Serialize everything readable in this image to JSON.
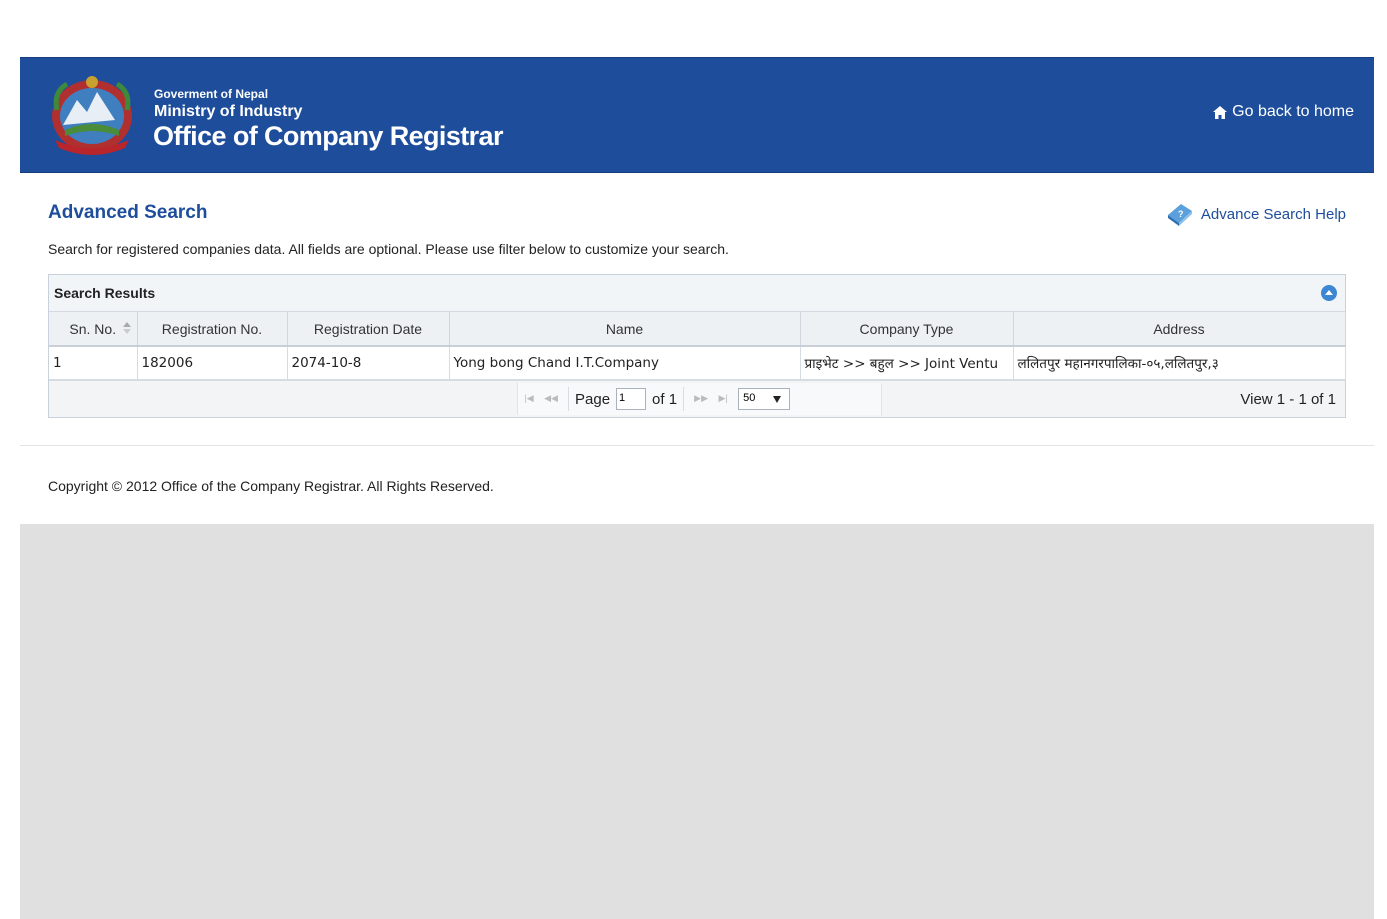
{
  "header": {
    "gov_line": "Goverment of Nepal",
    "ministry_line": "Ministry of Industry",
    "office_line": "Office of Company Registrar",
    "home_link": "Go back to home"
  },
  "main": {
    "title": "Advanced Search",
    "help_link": "Advance Search Help",
    "description": "Search for registered companies data. All fields are optional. Please use filter below to customize your search."
  },
  "grid": {
    "caption": "Search Results",
    "columns": [
      "Sn. No.",
      "Registration No.",
      "Registration Date",
      "Name",
      "Company Type",
      "Address"
    ],
    "rows": [
      [
        "1",
        "182006",
        "2074-10-8",
        "Yong bong Chand I.T.Company",
        "प्राइभेट >> बहुल >> Joint Ventu",
        "ललितपुर महानगरपालिका-०५,ललितपुर,३"
      ]
    ],
    "pager": {
      "page_label": "Page",
      "page_value": "1",
      "of_label": "of 1",
      "rows_per_page": "50",
      "view_text": "View 1 - 1 of 1"
    }
  },
  "footer": {
    "copyright": "Copyright © 2012 Office of the Company Registrar. All Rights Reserved."
  },
  "colors": {
    "header_bg": "#1d4d9b",
    "title_blue": "#1d4d9b",
    "page_bg": "#e1e0e1"
  }
}
